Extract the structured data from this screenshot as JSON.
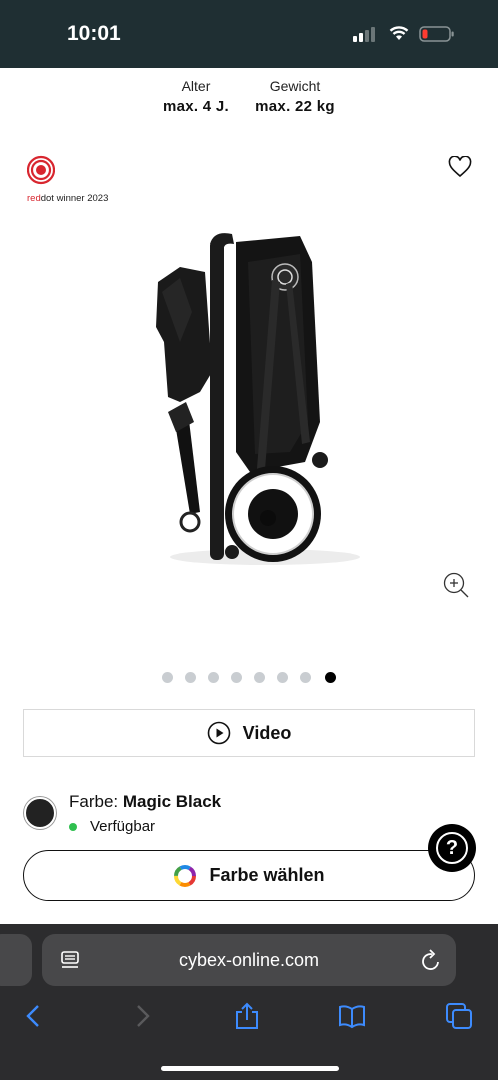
{
  "status_bar": {
    "time": "10:01"
  },
  "specs": [
    {
      "label": "Alter",
      "value": "max. 4 J."
    },
    {
      "label": "Gewicht",
      "value": "max. 22 kg"
    }
  ],
  "award": {
    "brand_red": "red",
    "brand_dot": "dot",
    "rest": " winner 2023"
  },
  "gallery": {
    "dot_count": 8,
    "active_index": 7
  },
  "video_button": {
    "label": "Video"
  },
  "color": {
    "prefix": "Farbe: ",
    "name": "Magic Black",
    "availability": "Verfügbar",
    "swatch": "#222222",
    "available_color": "#2fbf4f"
  },
  "choose_color_button": {
    "label": "Farbe wählen"
  },
  "help_button": {
    "label": "?"
  },
  "browser": {
    "url": "cybex-online.com"
  },
  "colors": {
    "status_bg": "#1f2f33",
    "browser_bg": "#2c2c2e",
    "accent_blue": "#3d8bfd",
    "reddot_red": "#d8262f"
  }
}
